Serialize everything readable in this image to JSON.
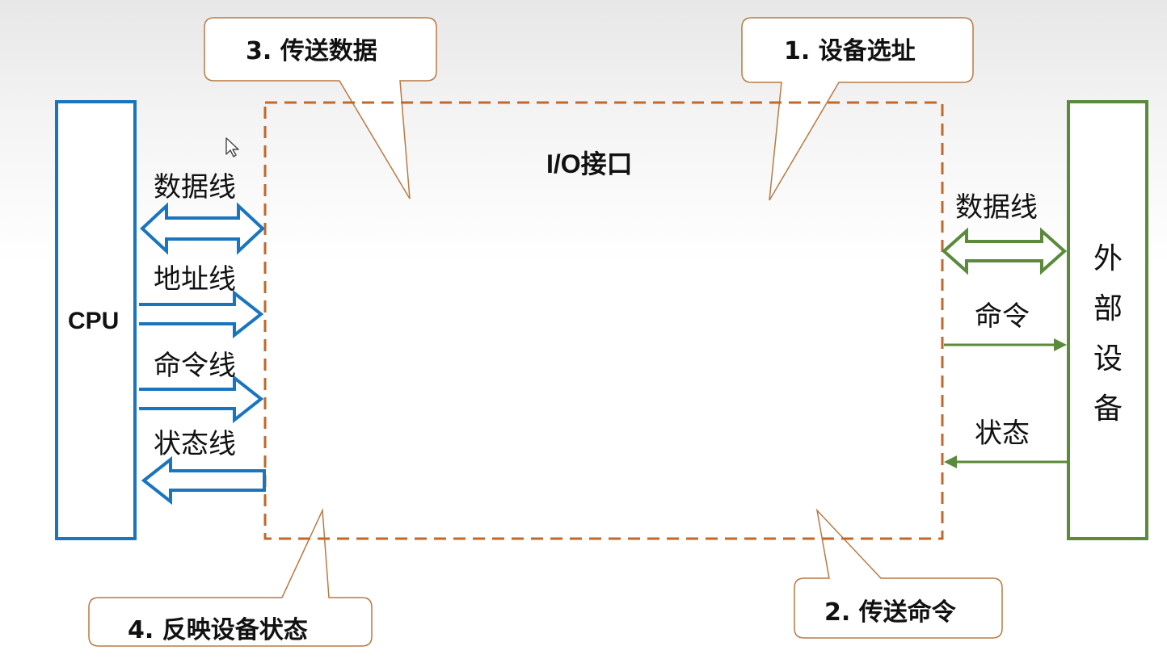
{
  "callouts": {
    "c3": "3. 传送数据",
    "c1": "1. 设备选址",
    "c4": "4. 反映设备状态",
    "c2": "2. 传送命令"
  },
  "cpu": {
    "label": "CPU"
  },
  "io": {
    "label": "I/O接口"
  },
  "device": {
    "chars": [
      "外",
      "部",
      "设",
      "备"
    ]
  },
  "cpu_lines": {
    "data": "数据线",
    "address": "地址线",
    "command": "命令线",
    "status": "状态线"
  },
  "device_lines": {
    "data": "数据线",
    "command": "命令",
    "status": "状态"
  },
  "colors": {
    "cpu_blue": "#1a75bf",
    "device_green": "#5a8a3a",
    "io_dashed": "#c0692a",
    "callout_border": "#b87a44"
  }
}
